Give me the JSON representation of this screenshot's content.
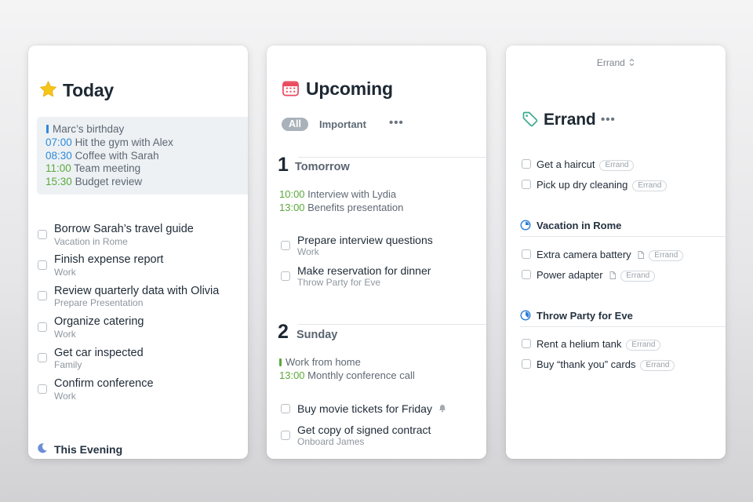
{
  "today": {
    "title": "Today",
    "title_icon": "star-icon",
    "calendar": [
      {
        "time": "",
        "text": "Marc’s birthday",
        "color": "#2f8ad8",
        "all_day": true
      },
      {
        "time": "07:00",
        "text": "Hit the gym with Alex",
        "color": "#2f8ad8"
      },
      {
        "time": "08:30",
        "text": "Coffee with Sarah",
        "color": "#2f8ad8"
      },
      {
        "time": "11:00",
        "text": "Team meeting",
        "color": "#5aa93b"
      },
      {
        "time": "15:30",
        "text": "Budget review",
        "color": "#5aa93b"
      }
    ],
    "tasks": [
      {
        "title": "Borrow Sarah’s travel guide",
        "project": "Vacation in Rome"
      },
      {
        "title": "Finish expense report",
        "project": "Work"
      },
      {
        "title": "Review quarterly data with Olivia",
        "project": "Prepare Presentation"
      },
      {
        "title": "Organize catering",
        "project": "Work"
      },
      {
        "title": "Get car inspected",
        "project": "Family"
      },
      {
        "title": "Confirm conference",
        "project": "Work"
      }
    ],
    "evening_label": "This Evening",
    "evening_icon": "moon-icon"
  },
  "upcoming": {
    "title": "Upcoming",
    "title_icon": "calendar-icon",
    "filters": {
      "all": "All",
      "important": "Important",
      "more": "•••"
    },
    "days": [
      {
        "number": "1",
        "name": "Tomorrow",
        "events": [
          {
            "time": "10:00",
            "text": "Interview with Lydia"
          },
          {
            "time": "13:00",
            "text": "Benefits presentation"
          }
        ],
        "tasks": [
          {
            "title": "Prepare interview questions",
            "project": "Work"
          },
          {
            "title": "Make reservation for dinner",
            "project": "Throw Party for Eve"
          }
        ]
      },
      {
        "number": "2",
        "name": "Sunday",
        "events": [
          {
            "time": "",
            "text": "Work from home",
            "all_day": true
          },
          {
            "time": "13:00",
            "text": "Monthly conference call"
          }
        ],
        "tasks": [
          {
            "title": "Buy movie tickets for Friday",
            "project": "",
            "icon": "bell-icon"
          },
          {
            "title": "Get copy of signed contract",
            "project": "Onboard James"
          }
        ]
      }
    ],
    "colors": {
      "green": "#5aa93b"
    }
  },
  "errand": {
    "selector_label": "Errand",
    "selector_icon": "up-down-chevron-icon",
    "title": "Errand",
    "title_icon": "tag-icon",
    "more": "•••",
    "tasks": [
      {
        "title": "Get a haircut",
        "tag": "Errand"
      },
      {
        "title": "Pick up dry cleaning",
        "tag": "Errand"
      }
    ],
    "projects": [
      {
        "name": "Vacation in Rome",
        "tasks": [
          {
            "title": "Extra camera battery",
            "tag": "Errand",
            "note": true
          },
          {
            "title": "Power adapter",
            "tag": "Errand",
            "note": true
          }
        ]
      },
      {
        "name": "Throw Party for Eve",
        "tasks": [
          {
            "title": "Rent a helium tank",
            "tag": "Errand"
          },
          {
            "title": "Buy “thank you” cards",
            "tag": "Errand"
          }
        ]
      }
    ],
    "colors": {
      "tag_icon": "#3aaa8e",
      "project_ring": "#2f7fd6"
    }
  }
}
